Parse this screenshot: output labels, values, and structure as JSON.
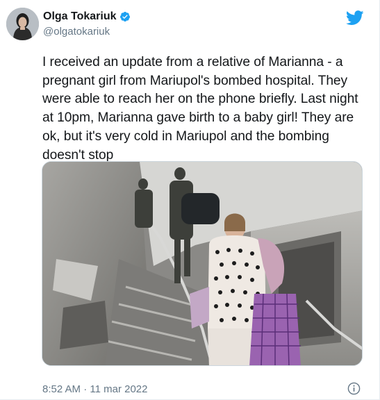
{
  "tweet": {
    "author_name": "Olga Tokariuk",
    "handle": "@olgatokariuk",
    "text": "I received an update from a relative of Marianna - a pregnant girl from Mariupol's bombed hospital. They were able to reach her on the phone briefly. Last night at 10pm, Marianna gave birth to a baby girl! They are ok, but it's very cold in Mariupol and the bombing doesn't stop",
    "timestamp": "8:52 AM · 11 mar 2022"
  },
  "icons": {
    "verified": "verified-badge-icon",
    "brand": "twitter-bird-icon",
    "info": "info-icon"
  },
  "colors": {
    "brand_blue": "#1da1f2",
    "text_primary": "#14171a",
    "text_secondary": "#657786"
  }
}
